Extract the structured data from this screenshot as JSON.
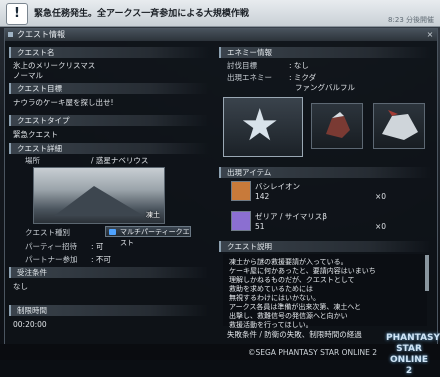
{
  "notice": {
    "icon": "!",
    "text": "緊急任務発生。全アークス一斉参加による大規模作戦",
    "time": "8:23 分後開催"
  },
  "window": {
    "title": "クエスト情報",
    "close": "×"
  },
  "left": {
    "quest_name_header": "クエスト名",
    "quest_name_1": "氷上のメリークリスマス",
    "quest_name_2": "ノーマル",
    "objective_header": "クエスト目標",
    "objective": "ナウラのケーキ屋を探し出せ!",
    "type_header": "クエストタイプ",
    "type": "緊急クエスト",
    "detail_header": "クエスト詳細",
    "location_label": "場所",
    "location_value": "/ 惑星ナベリウス",
    "area_caption": "凍土",
    "quest_kind_label": "クエスト種別",
    "quest_kind_value": "マルチパーティークエスト",
    "party_invite_label": "パーティー招待",
    "party_invite_value": ": 可",
    "partner_label": "パートナー参加",
    "partner_value": ": 不可",
    "accept_header": "受注条件",
    "accept_value": "なし",
    "time_limit_header": "制限時間",
    "time_limit_value": "00:20:00"
  },
  "right": {
    "enemy_header": "エネミー情報",
    "target_label": "討伐目標",
    "target_value": ": なし",
    "enemy_label": "出現エネミー",
    "enemy_value_1": ": ミクダ",
    "enemy_value_2": "ファングバルフル",
    "drop_header": "出現アイテム",
    "item1_name": "バシレイオン",
    "item1_count": "142",
    "item1_x": "×0",
    "item2_name": "ゼリア / サイマリスβ",
    "item2_count": "51",
    "item2_x": "×0",
    "desc_header": "クエスト説明",
    "description": "凍土から謎の救援要請が入っている。\nケーキ屋に何かあったと、要請内容はいまいち\n理解しかねるものだが、クエストとして\n救助を求めているためには\n無視するわけにはいかない。\nアークス各員は準備が出来次第、凍土へと\n出撃し、救難信号の発信源へと向かい\n救援活動を行ってほしい。",
    "fail_text": "失敗条件 / 防衛の失敗、制限時間の経過"
  },
  "footer": {
    "copyright": "©SEGA PHANTASY STAR ONLINE 2",
    "logo_line1": "PHANTASY STAR",
    "logo_line2": "ONLINE 2"
  },
  "colors": {
    "accent": "#8ca0b0",
    "notice_bg": "#dfe4e8",
    "button_icon": "#4fa3ff",
    "item1_icon": "#c87a3a",
    "item2_icon": "#8b6fd1"
  }
}
